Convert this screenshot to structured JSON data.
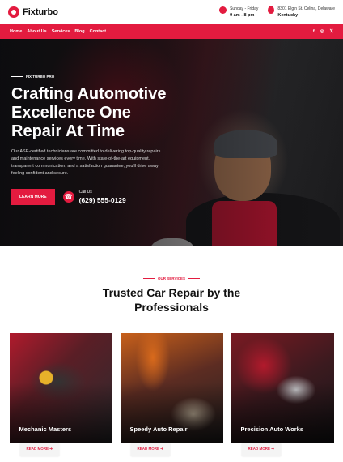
{
  "header": {
    "logo": "Fixturbo",
    "hours_label": "Sunday - Friday",
    "hours_value": "9 am - 8 pm",
    "address_line1": "8301 Elgin St. Celina, Delaware",
    "address_line2": "Kentucky"
  },
  "nav": {
    "links": [
      "Home",
      "About Us",
      "Services",
      "Blog",
      "Contact"
    ],
    "socials": [
      "f",
      "◎",
      "𝕏"
    ]
  },
  "hero": {
    "kicker": "FIX TURBO PRO",
    "title": "Crafting Automotive Excellence One Repair At Time",
    "description": "Our ASE-certified technicians are committed to delivering top-quality repairs and maintenance services every time. With state-of-the-art equipment, transparent communication, and a satisfaction guarantee, you'll drive away feeling confident and secure.",
    "button": "LEARN MORE",
    "call_label": "Call Us",
    "call_number": "(629) 555-0129"
  },
  "services": {
    "kicker": "OUR SERVICES",
    "title_line1": "Trusted Car Repair by the",
    "title_line2": "Professionals",
    "cards": [
      {
        "title": "Mechanic Masters",
        "cta": "READ MORE ➔"
      },
      {
        "title": "Speedy Auto Repair",
        "cta": "READ MORE ➔"
      },
      {
        "title": "Precision Auto Works",
        "cta": "READ MORE ➔"
      }
    ]
  },
  "colors": {
    "accent": "#e31b3f"
  }
}
